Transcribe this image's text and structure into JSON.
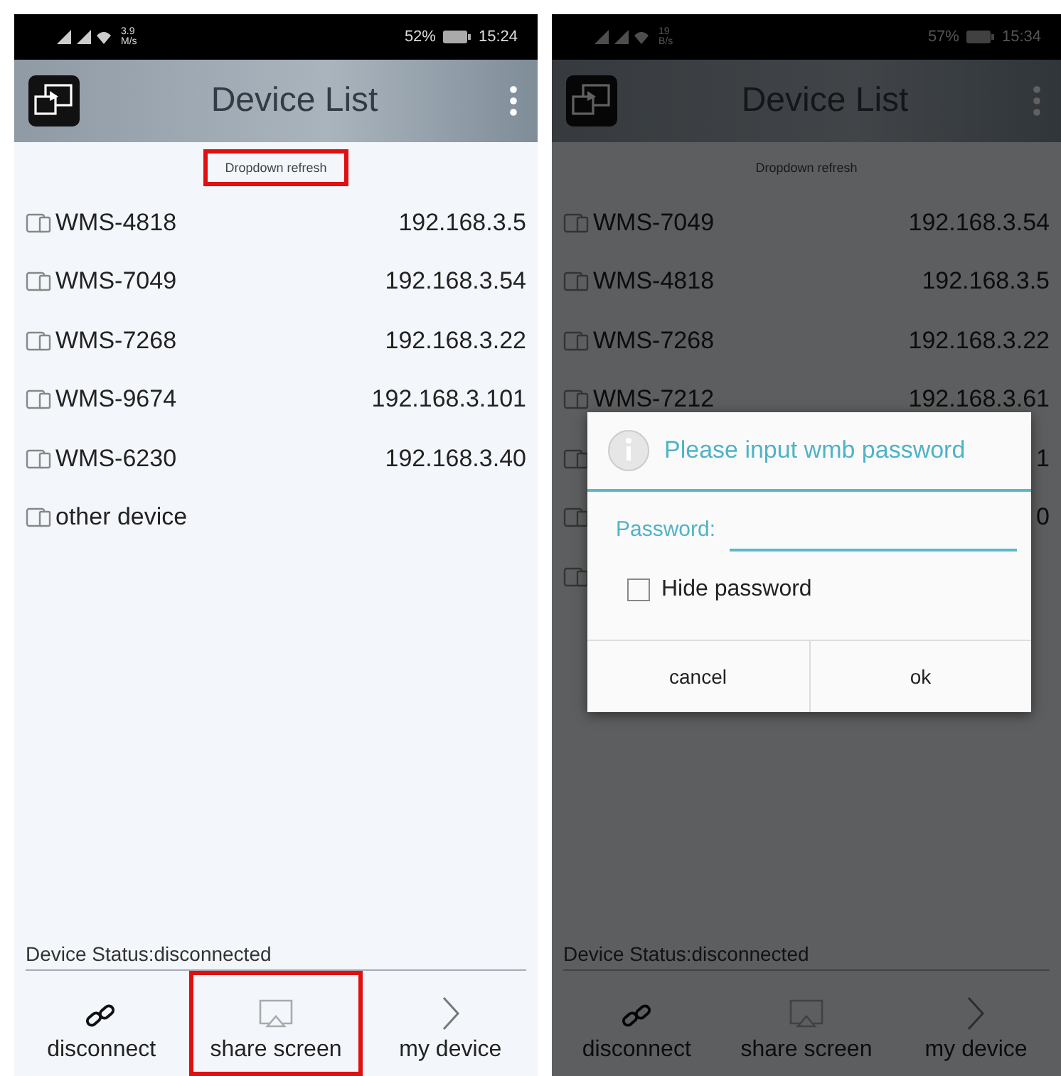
{
  "screens": [
    {
      "status_bar": {
        "speed": "3.9",
        "speed_unit": "M/s",
        "battery": "52%",
        "time": "15:24"
      },
      "title": "Device List",
      "refresh_hint": {
        "text": "Dropdown refresh",
        "highlighted": true
      },
      "devices": [
        {
          "kind": "full",
          "name": "WMS-4818",
          "ip": "192.168.3.5"
        },
        {
          "kind": "full",
          "name": "WMS-7049",
          "ip": "192.168.3.54"
        },
        {
          "kind": "full",
          "name": "WMS-7268",
          "ip": "192.168.3.22"
        },
        {
          "kind": "full",
          "name": "WMS-9674",
          "ip": "192.168.3.101"
        },
        {
          "kind": "full",
          "name": "WMS-6230",
          "ip": "192.168.3.40"
        },
        {
          "kind": "full",
          "name": "other device"
        }
      ],
      "device_status": "Device Status:disconnected",
      "nav": [
        {
          "kind": "link",
          "label": "disconnect",
          "highlighted": false
        },
        {
          "kind": "cast",
          "label": "share screen",
          "highlighted": true
        },
        {
          "kind": "chevron",
          "label": "my device",
          "highlighted": false
        }
      ]
    },
    {
      "status_bar": {
        "speed": "19",
        "speed_unit": "B/s",
        "battery": "57%",
        "time": "15:34"
      },
      "title": "Device List",
      "refresh_hint": {
        "text": "Dropdown refresh",
        "highlighted": false
      },
      "devices": [
        {
          "kind": "full",
          "name": "WMS-7049",
          "ip": "192.168.3.54"
        },
        {
          "kind": "full",
          "name": "WMS-4818",
          "ip": "192.168.3.5"
        },
        {
          "kind": "full",
          "name": "WMS-7268",
          "ip": "192.168.3.22"
        },
        {
          "kind": "full",
          "name": "WMS-7212",
          "ip": "192.168.3.61"
        },
        {
          "kind": "covered",
          "ip": "1"
        },
        {
          "kind": "covered",
          "ip": "0"
        },
        {
          "kind": "covered"
        }
      ],
      "device_status": "Device Status:disconnected",
      "nav": [
        {
          "kind": "link",
          "label": "disconnect",
          "highlighted": false
        },
        {
          "kind": "cast",
          "label": "share screen",
          "highlighted": false
        },
        {
          "kind": "chevron",
          "label": "my device",
          "highlighted": false
        }
      ],
      "dialog": {
        "title": "Please input wmb password",
        "field_label": "Password:",
        "checkbox": {
          "label": "Hide password",
          "checked": false
        },
        "buttons": [
          "cancel",
          "ok"
        ]
      }
    }
  ]
}
